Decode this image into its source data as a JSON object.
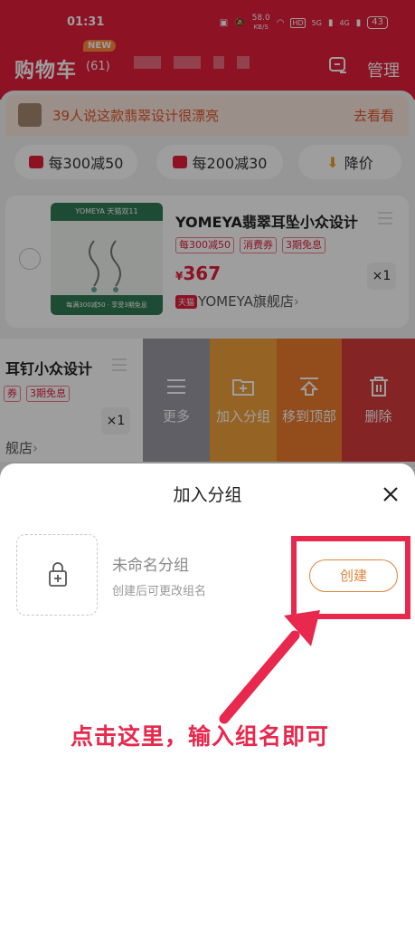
{
  "status_bar": {
    "time": "01:31",
    "net_speed_top": "58.0",
    "net_speed_unit": "KB/S",
    "hd": "HD",
    "sig1": "5G",
    "sig2": "4G",
    "battery": "43"
  },
  "header": {
    "title": "购物车",
    "count": "(61)",
    "new_badge": "NEW",
    "manage": "管理"
  },
  "promo": {
    "text": "39人说这款翡翠设计很漂亮",
    "link": "去看看"
  },
  "filters": [
    {
      "label": "每300减50",
      "icon": "shopping-bag-icon",
      "color": "#e21d3b"
    },
    {
      "label": "每200减30",
      "icon": "gift-icon",
      "color": "#e21d3b"
    },
    {
      "label": "降价",
      "icon": "price-drop-arrow-icon",
      "color": "#f0a020"
    }
  ],
  "item1": {
    "name": "YOMEYA翡翠耳坠小众设计",
    "tags": [
      "每300减50",
      "消费券",
      "3期免息"
    ],
    "currency": "¥",
    "price": "367",
    "qty": "×1",
    "tmall": "天猫",
    "shop": "YOMEYA旗舰店",
    "shop_arrow": "›",
    "img_top": "YOMEYA 天猫双11",
    "img_bottom": "每满300减50 · 享受3期免息"
  },
  "item2": {
    "name": "耳钉小众设计",
    "tags": [
      "券",
      "3期免息"
    ],
    "qty": "×1",
    "shop": "舰店",
    "shop_arrow": "›"
  },
  "swipe_actions": [
    {
      "label": "更多",
      "icon": "list-icon",
      "color": "#9a9aa4"
    },
    {
      "label": "加入分组",
      "icon": "folder-add-icon",
      "color": "#f0a23a"
    },
    {
      "label": "移到顶部",
      "icon": "move-top-icon",
      "color": "#ee7b2d"
    },
    {
      "label": "删除",
      "icon": "trash-icon",
      "color": "#d73a3a"
    }
  ],
  "sheet": {
    "title": "加入分组",
    "group_name": "未命名分组",
    "group_hint": "创建后可更改组名",
    "create_button": "创建"
  },
  "annotation": {
    "text": "点击这里，输入组名即可",
    "color": "#e8284d"
  }
}
